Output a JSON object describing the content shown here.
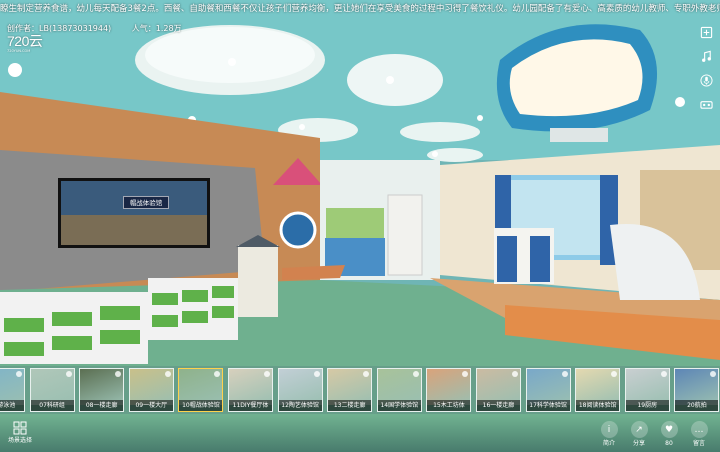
{
  "marquee": "瞭生制定营养食谱，幼儿每天配备3餐2点。西餐、自助餐和西餐不仅让孩子们营养均衡，更让她们在享受美食的过程中习得了餐饮礼仪。幼儿园配备了有爱心、高素质的幼儿教师、专职外教老师，及体智能老师，各班",
  "creator_label": "创作者：LB(13873031944)",
  "popularity_label": "人气：1.28万",
  "logo": {
    "big": "720云",
    "small": "720YUN.COM"
  },
  "right_tools": [
    {
      "name": "gyroscope-icon"
    },
    {
      "name": "music-icon"
    },
    {
      "name": "microphone-icon"
    },
    {
      "name": "vr-glasses-icon"
    }
  ],
  "screen_sign": "帽战体验馆",
  "thumbnails": [
    {
      "label": "05游泳池",
      "color": "#7fb4c9",
      "active": false
    },
    {
      "label": "07科研组",
      "color": "#b0c7b9",
      "active": false
    },
    {
      "label": "08一楼走廊",
      "color": "#5b6f52",
      "active": false
    },
    {
      "label": "09一楼大厅",
      "color": "#c9c08a",
      "active": false
    },
    {
      "label": "10帽战体验馆",
      "color": "#8fb28b",
      "active": true
    },
    {
      "label": "11DIY餐厅体",
      "color": "#d7d0bd",
      "active": false
    },
    {
      "label": "12陶艺体验馆",
      "color": "#c2cfd6",
      "active": false
    },
    {
      "label": "13二楼走廊",
      "color": "#d6c9a5",
      "active": false
    },
    {
      "label": "14国学体验馆",
      "color": "#a8c29a",
      "active": false
    },
    {
      "label": "15木工坊体",
      "color": "#d9a37b",
      "active": false
    },
    {
      "label": "16一楼走廊",
      "color": "#cbbba2",
      "active": false
    },
    {
      "label": "17科学体验馆",
      "color": "#79a8c9",
      "active": false
    },
    {
      "label": "18阅读体验馆",
      "color": "#e4d9b0",
      "active": false
    },
    {
      "label": "19厨房",
      "color": "#c9cfd1",
      "active": false
    },
    {
      "label": "20航拍",
      "color": "#5d86b6",
      "active": false
    }
  ],
  "bottom": {
    "scene_select": "场景选择",
    "intro": "简介",
    "share": "分享",
    "likes": "80",
    "comment": "留言"
  }
}
